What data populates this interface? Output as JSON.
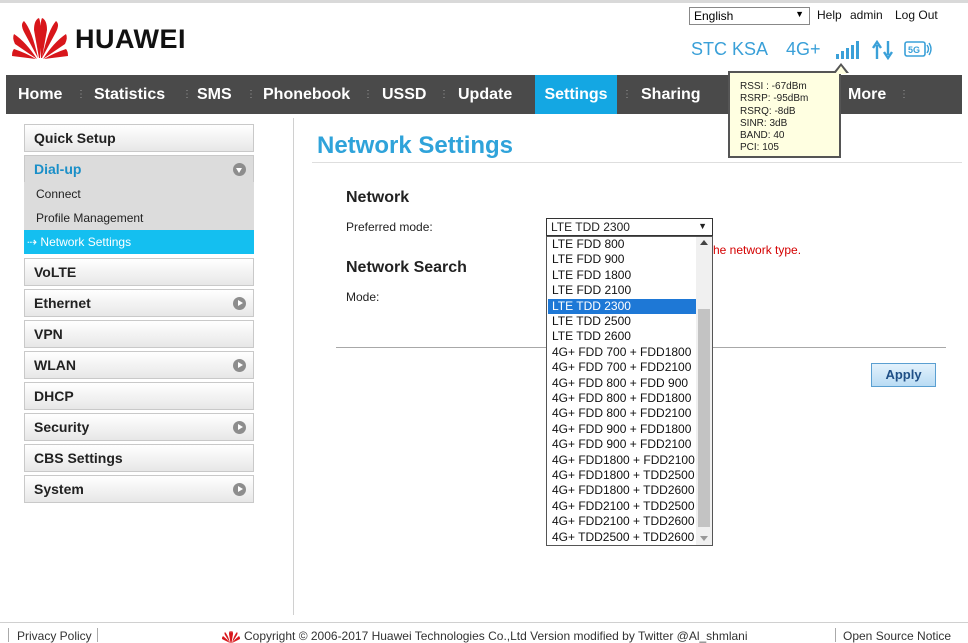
{
  "brand": {
    "name": "HUAWEI"
  },
  "top": {
    "language": "English",
    "help": "Help",
    "user": "admin",
    "logout": "Log Out"
  },
  "status": {
    "operator": "STC KSA",
    "network_type": "4G+",
    "signal_icon": "signal-bars-icon",
    "data_icon": "up-down-arrows-icon",
    "wifi_icon": "5g-wifi-icon"
  },
  "signal_tooltip": {
    "lines": [
      "RSSI : -67dBm",
      "RSRP: -95dBm",
      "RSRQ: -8dB",
      "SINR: 3dB",
      "BAND: 40",
      "PCI: 105"
    ]
  },
  "nav": {
    "items": [
      "Home",
      "Statistics",
      "SMS",
      "Phonebook",
      "USSD",
      "Update",
      "Settings",
      "Sharing",
      "More"
    ],
    "active": "Settings"
  },
  "sidebar": {
    "quick_setup": "Quick Setup",
    "dialup": "Dial-up",
    "dialup_subs": [
      "Connect",
      "Profile Management",
      "Network Settings"
    ],
    "active_prefix": "⇢",
    "items": [
      "VoLTE",
      "Ethernet",
      "VPN",
      "WLAN",
      "DHCP",
      "Security",
      "CBS Settings",
      "System"
    ]
  },
  "main": {
    "title": "Network Settings",
    "network_section": "Network",
    "preferred_mode_label": "Preferred mode:",
    "preferred_mode_value": "LTE TDD 2300",
    "hint_text": "he network type.",
    "network_search_section": "Network Search",
    "mode_label": "Mode:",
    "apply": "Apply"
  },
  "dropdown": {
    "options": [
      "LTE FDD 800",
      "LTE FDD 900",
      "LTE FDD 1800",
      "LTE FDD 2100",
      "LTE TDD 2300",
      "LTE TDD 2500",
      "LTE TDD 2600",
      "4G+ FDD 700 + FDD1800",
      "4G+ FDD 700 + FDD2100",
      "4G+ FDD 800 + FDD 900",
      "4G+ FDD 800 + FDD1800",
      "4G+ FDD 800 + FDD2100",
      "4G+ FDD 900 + FDD1800",
      "4G+ FDD 900 + FDD2100",
      "4G+ FDD1800 + FDD2100",
      "4G+ FDD1800 + TDD2500",
      "4G+ FDD1800 + TDD2600",
      "4G+ FDD2100 + TDD2500",
      "4G+ FDD2100 + TDD2600",
      "4G+ TDD2500 + TDD2600"
    ],
    "selected_index": 4
  },
  "footer": {
    "privacy": "Privacy Policy",
    "copyright": "Copyright © 2006-2017 Huawei Technologies Co.,Ltd Version modified by Twitter @Al_shmlani",
    "open_source": "Open Source Notice"
  },
  "colors": {
    "accent": "#2fa3da",
    "nav_bg": "#4a4a4a",
    "nav_active": "#14a7e3",
    "huawei_red": "#d8161b"
  }
}
